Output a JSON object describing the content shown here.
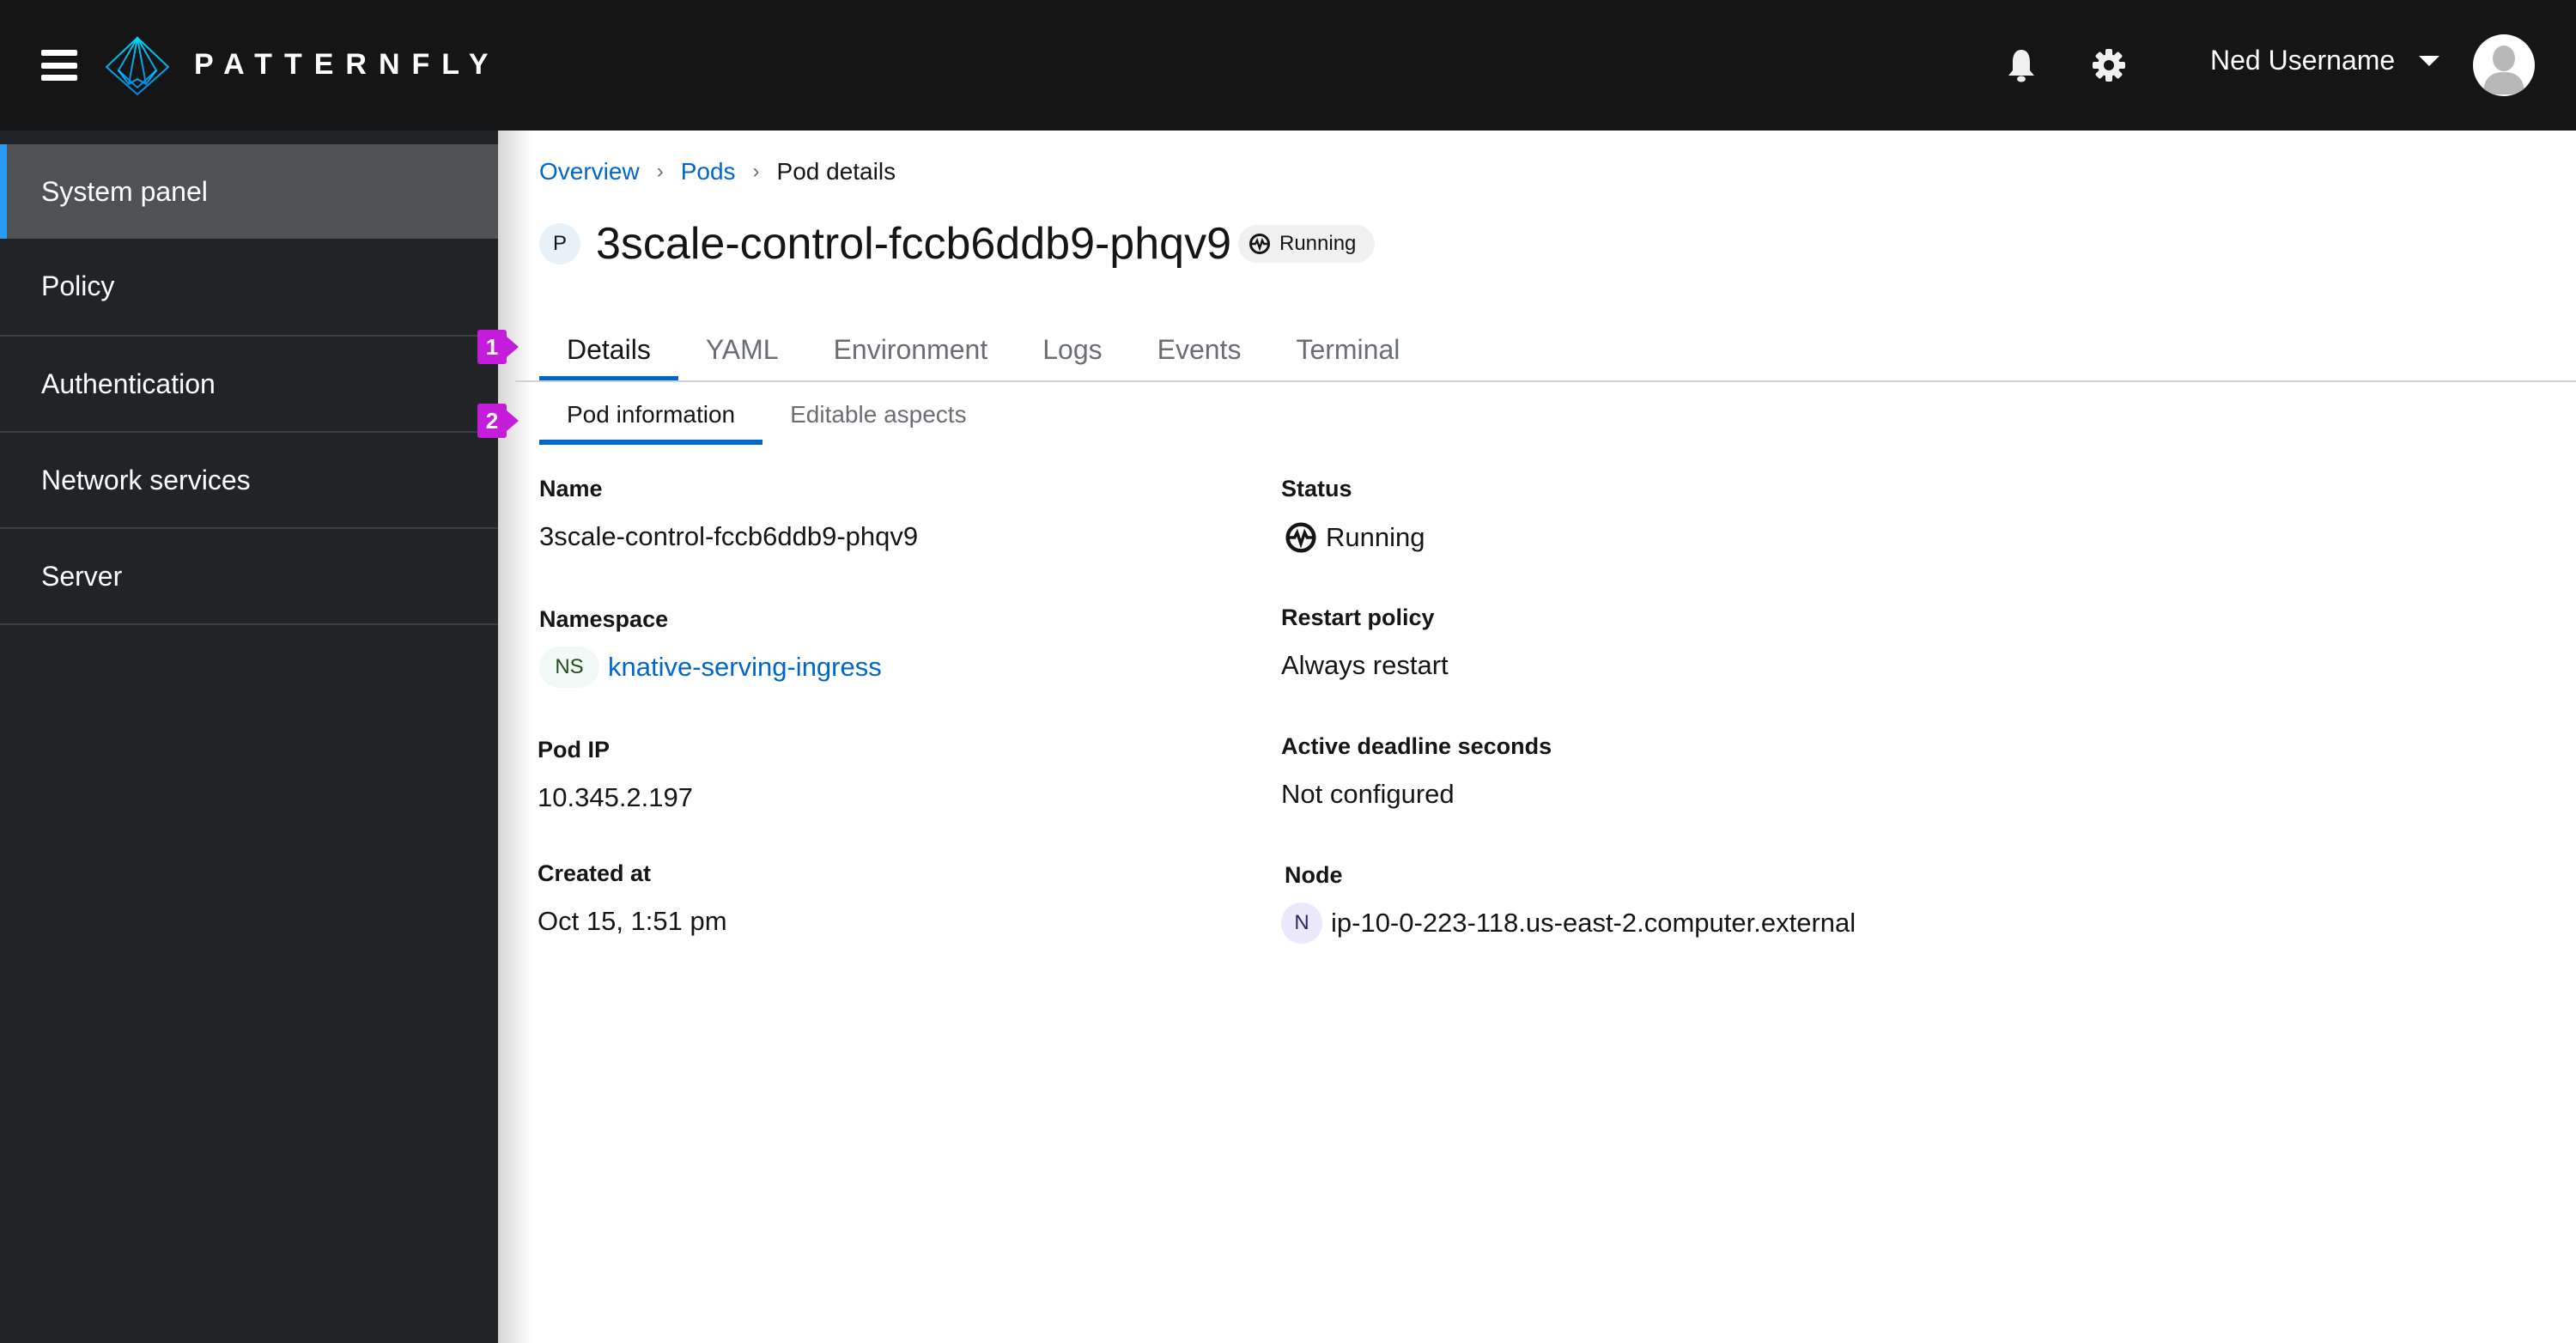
{
  "masthead": {
    "brand": "PATTERNFLY",
    "user_name": "Ned Username",
    "icons": [
      "menu-icon",
      "patternfly-logo-icon",
      "bell-icon",
      "gear-icon",
      "caret-down-icon",
      "avatar-icon"
    ]
  },
  "sidebar": {
    "items": [
      {
        "label": "System panel",
        "active": true
      },
      {
        "label": "Policy",
        "active": false
      },
      {
        "label": "Authentication",
        "active": false
      },
      {
        "label": "Network services",
        "active": false
      },
      {
        "label": "Server",
        "active": false
      }
    ]
  },
  "breadcrumb": {
    "items": [
      "Overview",
      "Pods"
    ],
    "current": "Pod details"
  },
  "header": {
    "resource_badge": "P",
    "title": "3scale-control-fccb6ddb9-phqv9",
    "status": "Running"
  },
  "tabs": [
    {
      "label": "Details",
      "active": true
    },
    {
      "label": "YAML",
      "active": false
    },
    {
      "label": "Environment",
      "active": false
    },
    {
      "label": "Logs",
      "active": false
    },
    {
      "label": "Events",
      "active": false
    },
    {
      "label": "Terminal",
      "active": false
    }
  ],
  "subtabs": [
    {
      "label": "Pod information",
      "active": true
    },
    {
      "label": "Editable aspects",
      "active": false
    }
  ],
  "markers": [
    "1",
    "2"
  ],
  "details": {
    "left": [
      {
        "label": "Name",
        "value": "3scale-control-fccb6ddb9-phqv9"
      },
      {
        "label": "Namespace",
        "badge": "NS",
        "value": "knative-serving-ingress"
      },
      {
        "label": "Pod IP",
        "value": "10.345.2.197"
      },
      {
        "label": "Created at",
        "value": "Oct 15, 1:51 pm"
      }
    ],
    "right": [
      {
        "label": "Status",
        "value": "Running"
      },
      {
        "label": "Restart policy",
        "value": "Always restart"
      },
      {
        "label": "Active deadline seconds",
        "value": "Not configured"
      },
      {
        "label": "Node",
        "badge": "N",
        "value": "ip-10-0-223-118.us-east-2.computer.external"
      }
    ]
  },
  "colors": {
    "accent": "#0066cc",
    "sidebar_active_bar": "#2b9af3",
    "marker": "#c51bdb",
    "masthead_bg": "#151515",
    "sidebar_bg": "#212427"
  }
}
